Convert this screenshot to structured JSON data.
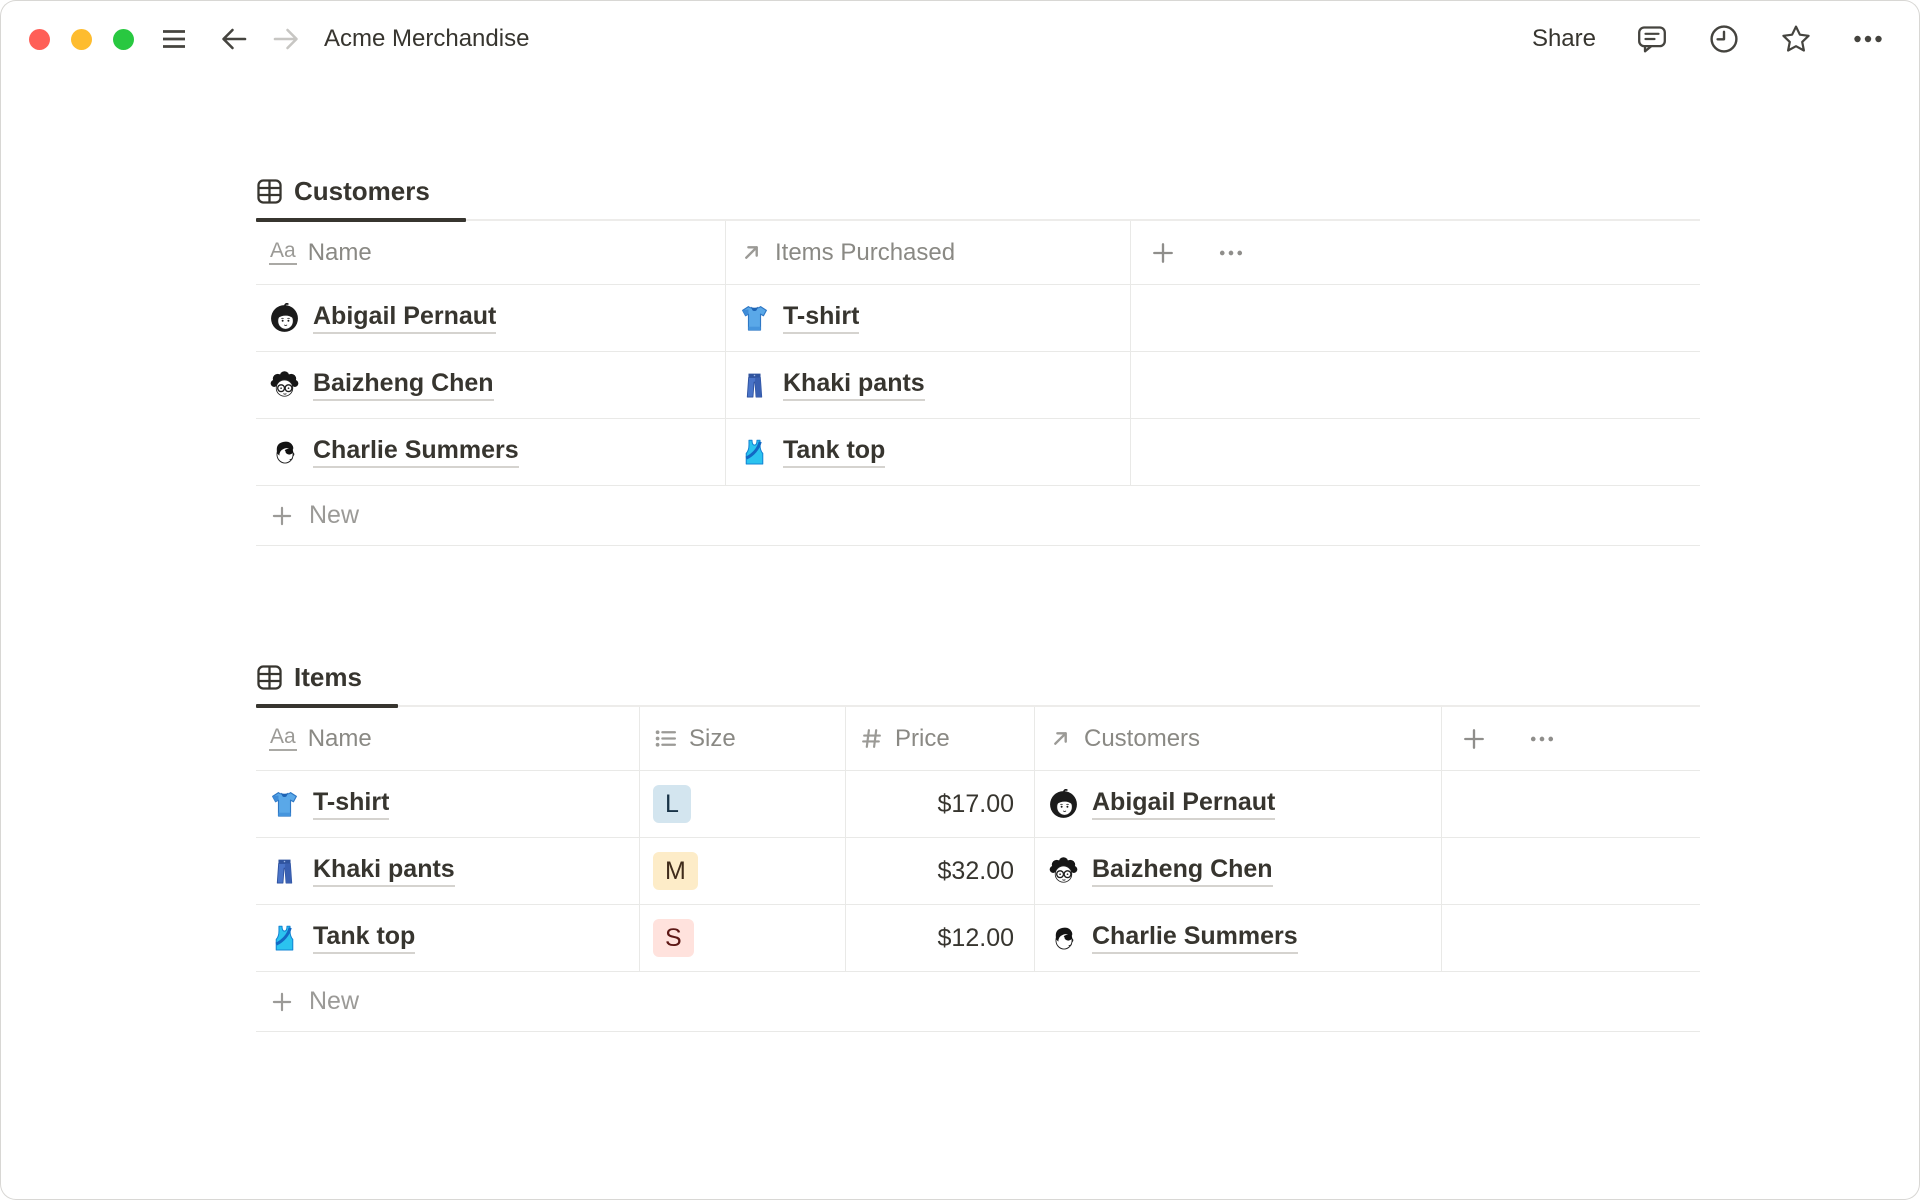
{
  "window": {
    "title": "Acme Merchandise",
    "traffic_lights": {
      "close": "#ff5f57",
      "minimize": "#febc2e",
      "zoom": "#28c840"
    },
    "toolbar": {
      "share_label": "Share"
    }
  },
  "icons": {
    "text_property_glyph": "Aa",
    "names": [
      "hamburger-icon",
      "back-arrow-icon",
      "forward-arrow-icon",
      "comment-icon",
      "clock-icon",
      "star-icon",
      "ellipsis-icon",
      "table-icon",
      "text-property-icon",
      "relation-icon",
      "select-icon",
      "number-icon",
      "plus-icon",
      "avatar",
      "tshirt-emoji",
      "jeans-emoji",
      "tank-top-emoji"
    ]
  },
  "colors": {
    "text": "#37352f",
    "muted": "#9b9a97",
    "border": "#e9e9e7",
    "tab_underline": "#37352f"
  },
  "customers_table": {
    "tab": "Customers",
    "columns": {
      "name": "Name",
      "items_purchased": "Items Purchased"
    },
    "rows": [
      {
        "name": "Abigail Pernaut",
        "item": "T-shirt"
      },
      {
        "name": "Baizheng Chen",
        "item": "Khaki pants"
      },
      {
        "name": "Charlie Summers",
        "item": "Tank top"
      }
    ],
    "new_label": "New"
  },
  "items_table": {
    "tab": "Items",
    "columns": {
      "name": "Name",
      "size": "Size",
      "price": "Price",
      "customers": "Customers"
    },
    "rows": [
      {
        "name": "T-shirt",
        "size": "L",
        "size_bg": "#d3e5ef",
        "size_fg": "#183347",
        "price": "$17.00",
        "customer": "Abigail Pernaut"
      },
      {
        "name": "Khaki pants",
        "size": "M",
        "size_bg": "#fdecc8",
        "size_fg": "#402c1b",
        "price": "$32.00",
        "customer": "Baizheng Chen"
      },
      {
        "name": "Tank top",
        "size": "S",
        "size_bg": "#ffe2dd",
        "size_fg": "#5d1715",
        "price": "$12.00",
        "customer": "Charlie Summers"
      }
    ],
    "new_label": "New"
  }
}
